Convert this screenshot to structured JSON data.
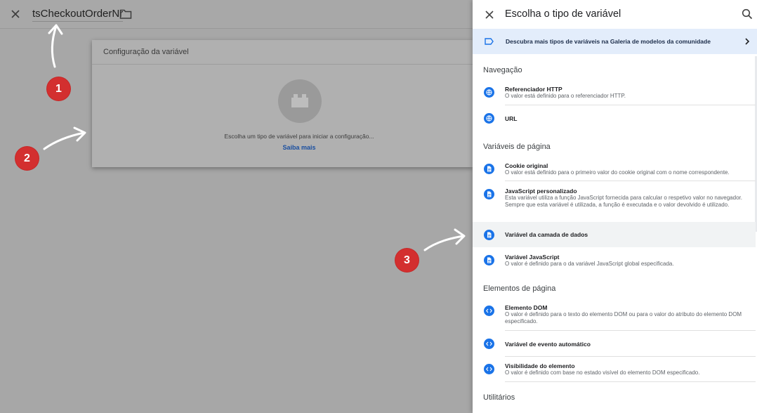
{
  "topbar": {
    "variable_name": "tsCheckoutOrderNr"
  },
  "config_card": {
    "header": "Configuração da variável",
    "hint": "Escolha um tipo de variável para iniciar a configuração...",
    "learn_more": "Saiba mais"
  },
  "annotations": [
    "1",
    "2",
    "3"
  ],
  "panel": {
    "title": "Escolha o tipo de variável",
    "banner": "Descubra mais tipos de variáveis na Galeria de modelos da comunidade",
    "sections": {
      "nav": "Navegação",
      "page_vars": "Variáveis de página",
      "page_elements": "Elementos de página",
      "utilities": "Utilitários"
    },
    "items": {
      "http_referrer": {
        "title": "Referenciador HTTP",
        "desc": "O valor está definido para o referenciador HTTP."
      },
      "url": {
        "title": "URL"
      },
      "cookie": {
        "title": "Cookie original",
        "desc": "O valor está definido para o primeiro valor do cookie original com o nome correspondente."
      },
      "custom_js": {
        "title": "JavaScript personalizado",
        "desc": "Esta variável utiliza a função JavaScript fornecida para calcular o respetivo valor no navegador. Sempre que esta variável é utilizada, a função é executada e o valor devolvido é utilizado."
      },
      "datalayer": {
        "title": "Variável da camada de dados"
      },
      "js_var": {
        "title": "Variável JavaScript",
        "desc": "O valor é definido para o da variável JavaScript global especificada."
      },
      "dom": {
        "title": "Elemento DOM",
        "desc": "O valor é definido para o texto do elemento DOM ou para o valor do atributo do elemento DOM especificado."
      },
      "auto_event": {
        "title": "Variável de evento automático"
      },
      "visibility": {
        "title": "Visibilidade do elemento",
        "desc": "O valor é definido com base no estado visível do elemento DOM especificado."
      }
    }
  }
}
